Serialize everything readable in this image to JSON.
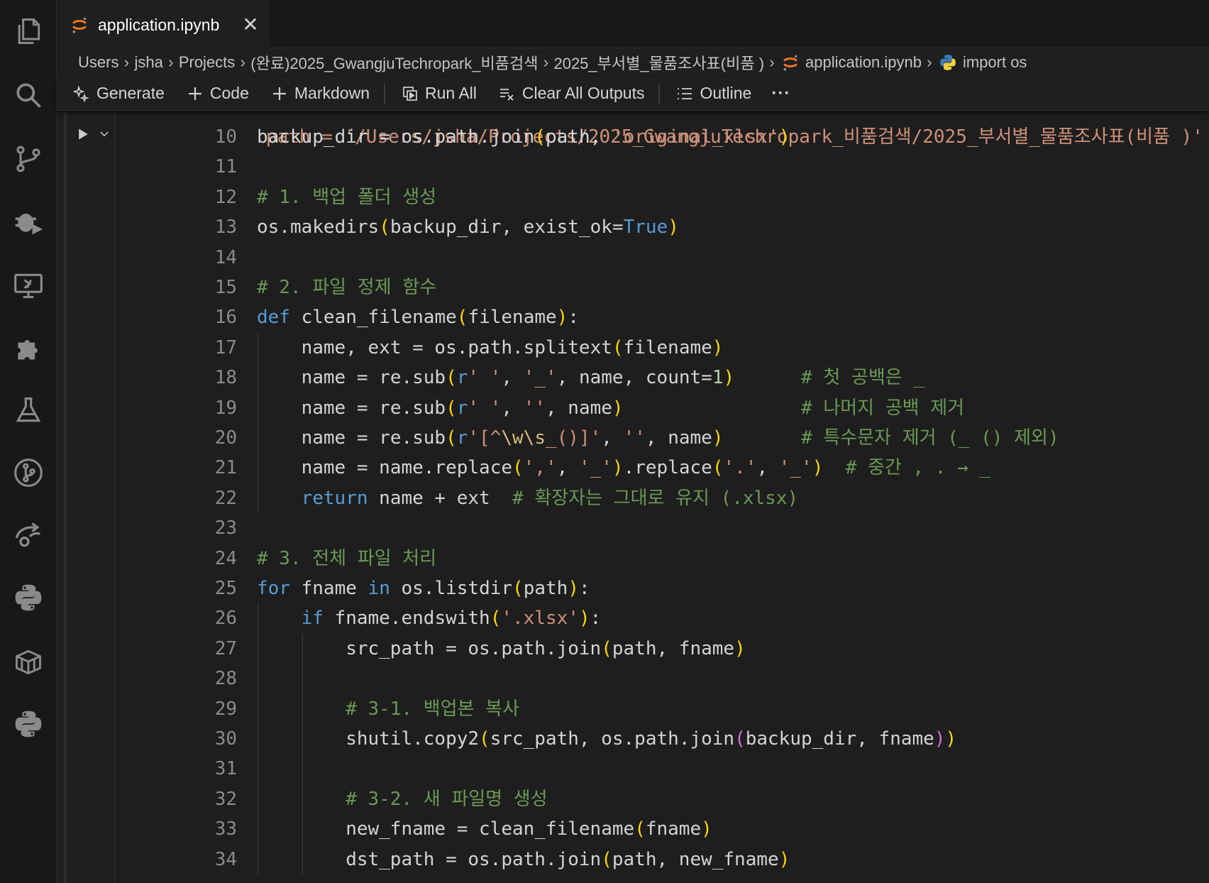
{
  "editor": {
    "tab": {
      "title": "application.ipynb",
      "close_glyph": "✕"
    },
    "breadcrumb": [
      {
        "text": "Users"
      },
      {
        "text": "jsha"
      },
      {
        "text": "Projects"
      },
      {
        "text": "(완료)2025_GwangjuTechropark_비품검색"
      },
      {
        "text": "2025_부서별_물품조사표(비품 )"
      },
      {
        "text": "application.ipynb",
        "icon": "jupyter-icon"
      },
      {
        "text": "import os",
        "icon": "python-icon"
      }
    ],
    "breadcrumb_separator": "›",
    "toolbar": {
      "generate": "Generate",
      "code": "Code",
      "markdown": "Markdown",
      "run_all": "Run All",
      "clear_all_outputs": "Clear All Outputs",
      "outline": "Outline",
      "more": "···"
    },
    "top_partial_line": "path = '/Users/jsha/Projects/2025_GwangjuTechropark_비품검색/2025_부서별_물품조사표(비품 )'",
    "code_lines": [
      {
        "n": "10",
        "indent": 0,
        "tokens": [
          [
            "pl",
            "backup_dir = os.path.join"
          ],
          [
            "p1",
            "("
          ],
          [
            "pl",
            "path, "
          ],
          [
            "str",
            "'original_xlsx'"
          ],
          [
            "p1",
            ")"
          ]
        ]
      },
      {
        "n": "11",
        "indent": 0,
        "tokens": []
      },
      {
        "n": "12",
        "indent": 0,
        "tokens": [
          [
            "cmt",
            "# 1. 백업 폴더 생성"
          ]
        ]
      },
      {
        "n": "13",
        "indent": 0,
        "tokens": [
          [
            "pl",
            "os.makedirs"
          ],
          [
            "p1",
            "("
          ],
          [
            "pl",
            "backup_dir, exist_ok="
          ],
          [
            "bool",
            "True"
          ],
          [
            "p1",
            ")"
          ]
        ]
      },
      {
        "n": "14",
        "indent": 0,
        "tokens": []
      },
      {
        "n": "15",
        "indent": 0,
        "tokens": [
          [
            "cmt",
            "# 2. 파일 정제 함수"
          ]
        ]
      },
      {
        "n": "16",
        "indent": 0,
        "tokens": [
          [
            "kw",
            "def"
          ],
          [
            "pl",
            " clean_filename"
          ],
          [
            "p1",
            "("
          ],
          [
            "pl",
            "filename"
          ],
          [
            "p1",
            ")"
          ],
          [
            "pl",
            ":"
          ]
        ]
      },
      {
        "n": "17",
        "indent": 1,
        "tokens": [
          [
            "pl",
            "name, ext = os.path.splitext"
          ],
          [
            "p1",
            "("
          ],
          [
            "pl",
            "filename"
          ],
          [
            "p1",
            ")"
          ]
        ]
      },
      {
        "n": "18",
        "indent": 1,
        "tokens": [
          [
            "pl",
            "name = re.sub"
          ],
          [
            "p1",
            "("
          ],
          [
            "kw",
            "r"
          ],
          [
            "str",
            "' '"
          ],
          [
            "pl",
            ", "
          ],
          [
            "str",
            "'_'"
          ],
          [
            "pl",
            ", name, count="
          ],
          [
            "num",
            "1"
          ],
          [
            "p1",
            ")"
          ],
          [
            "pl",
            "      "
          ],
          [
            "cmt",
            "# 첫 공백은 _"
          ]
        ]
      },
      {
        "n": "19",
        "indent": 1,
        "tokens": [
          [
            "pl",
            "name = re.sub"
          ],
          [
            "p1",
            "("
          ],
          [
            "kw",
            "r"
          ],
          [
            "str",
            "' '"
          ],
          [
            "pl",
            ", "
          ],
          [
            "str",
            "''"
          ],
          [
            "pl",
            ", name"
          ],
          [
            "p1",
            ")"
          ],
          [
            "pl",
            "                "
          ],
          [
            "cmt",
            "# 나머지 공백 제거"
          ]
        ]
      },
      {
        "n": "20",
        "indent": 1,
        "tokens": [
          [
            "pl",
            "name = re.sub"
          ],
          [
            "p1",
            "("
          ],
          [
            "kw",
            "r"
          ],
          [
            "str",
            "'[^"
          ],
          [
            "esc",
            "\\w\\s"
          ],
          [
            "str",
            "_()]'"
          ],
          [
            "pl",
            ", "
          ],
          [
            "str",
            "''"
          ],
          [
            "pl",
            ", name"
          ],
          [
            "p1",
            ")"
          ],
          [
            "pl",
            "       "
          ],
          [
            "cmt",
            "# 특수문자 제거 (_ () 제외)"
          ]
        ]
      },
      {
        "n": "21",
        "indent": 1,
        "tokens": [
          [
            "pl",
            "name = name.replace"
          ],
          [
            "p1",
            "("
          ],
          [
            "str",
            "','"
          ],
          [
            "pl",
            ", "
          ],
          [
            "str",
            "'_'"
          ],
          [
            "p1",
            ")"
          ],
          [
            "pl",
            ".replace"
          ],
          [
            "p1",
            "("
          ],
          [
            "str",
            "'.'"
          ],
          [
            "pl",
            ", "
          ],
          [
            "str",
            "'_'"
          ],
          [
            "p1",
            ")"
          ],
          [
            "pl",
            "  "
          ],
          [
            "cmt",
            "# 중간 , . → _"
          ]
        ]
      },
      {
        "n": "22",
        "indent": 1,
        "tokens": [
          [
            "kw",
            "return"
          ],
          [
            "pl",
            " name + ext  "
          ],
          [
            "cmt",
            "# 확장자는 그대로 유지 (.xlsx)"
          ]
        ]
      },
      {
        "n": "23",
        "indent": 0,
        "tokens": []
      },
      {
        "n": "24",
        "indent": 0,
        "tokens": [
          [
            "cmt",
            "# 3. 전체 파일 처리"
          ]
        ]
      },
      {
        "n": "25",
        "indent": 0,
        "tokens": [
          [
            "kw",
            "for"
          ],
          [
            "pl",
            " fname "
          ],
          [
            "kw",
            "in"
          ],
          [
            "pl",
            " os.listdir"
          ],
          [
            "p1",
            "("
          ],
          [
            "pl",
            "path"
          ],
          [
            "p1",
            ")"
          ],
          [
            "pl",
            ":"
          ]
        ]
      },
      {
        "n": "26",
        "indent": 1,
        "tokens": [
          [
            "kw",
            "if"
          ],
          [
            "pl",
            " fname.endswith"
          ],
          [
            "p1",
            "("
          ],
          [
            "str",
            "'.xlsx'"
          ],
          [
            "p1",
            ")"
          ],
          [
            "pl",
            ":"
          ]
        ]
      },
      {
        "n": "27",
        "indent": 2,
        "tokens": [
          [
            "pl",
            "src_path = os.path.join"
          ],
          [
            "p1",
            "("
          ],
          [
            "pl",
            "path, fname"
          ],
          [
            "p1",
            ")"
          ]
        ]
      },
      {
        "n": "28",
        "indent": 2,
        "tokens": []
      },
      {
        "n": "29",
        "indent": 2,
        "tokens": [
          [
            "cmt",
            "# 3-1. 백업본 복사"
          ]
        ]
      },
      {
        "n": "30",
        "indent": 2,
        "tokens": [
          [
            "pl",
            "shutil.copy2"
          ],
          [
            "p1",
            "("
          ],
          [
            "pl",
            "src_path, os.path.join"
          ],
          [
            "p2",
            "("
          ],
          [
            "pl",
            "backup_dir, fname"
          ],
          [
            "p2",
            ")"
          ],
          [
            "p1",
            ")"
          ]
        ]
      },
      {
        "n": "31",
        "indent": 2,
        "tokens": []
      },
      {
        "n": "32",
        "indent": 2,
        "tokens": [
          [
            "cmt",
            "# 3-2. 새 파일명 생성"
          ]
        ]
      },
      {
        "n": "33",
        "indent": 2,
        "tokens": [
          [
            "pl",
            "new_fname = clean_filename"
          ],
          [
            "p1",
            "("
          ],
          [
            "pl",
            "fname"
          ],
          [
            "p1",
            ")"
          ]
        ]
      },
      {
        "n": "34",
        "indent": 2,
        "tokens": [
          [
            "pl",
            "dst_path = os.path.join"
          ],
          [
            "p1",
            "("
          ],
          [
            "pl",
            "path, new_fname"
          ],
          [
            "p1",
            ")"
          ]
        ]
      }
    ],
    "colors": {
      "keyword": "#569cd6",
      "string": "#ce9178",
      "comment": "#6a9955",
      "number": "#b5cea8",
      "bracket_level1": "#ffd700",
      "bracket_level2": "#da70d6",
      "jupyter_accent": "#f37626"
    }
  },
  "activity_bar": [
    {
      "name": "explorer-icon"
    },
    {
      "name": "search-icon"
    },
    {
      "name": "source-control-icon"
    },
    {
      "name": "run-debug-icon"
    },
    {
      "name": "remote-explorer-icon"
    },
    {
      "name": "extensions-icon"
    },
    {
      "name": "testing-icon"
    },
    {
      "name": "git-graph-icon"
    },
    {
      "name": "live-share-icon"
    },
    {
      "name": "python-icon"
    },
    {
      "name": "containers-icon"
    },
    {
      "name": "python-environments-icon"
    }
  ]
}
